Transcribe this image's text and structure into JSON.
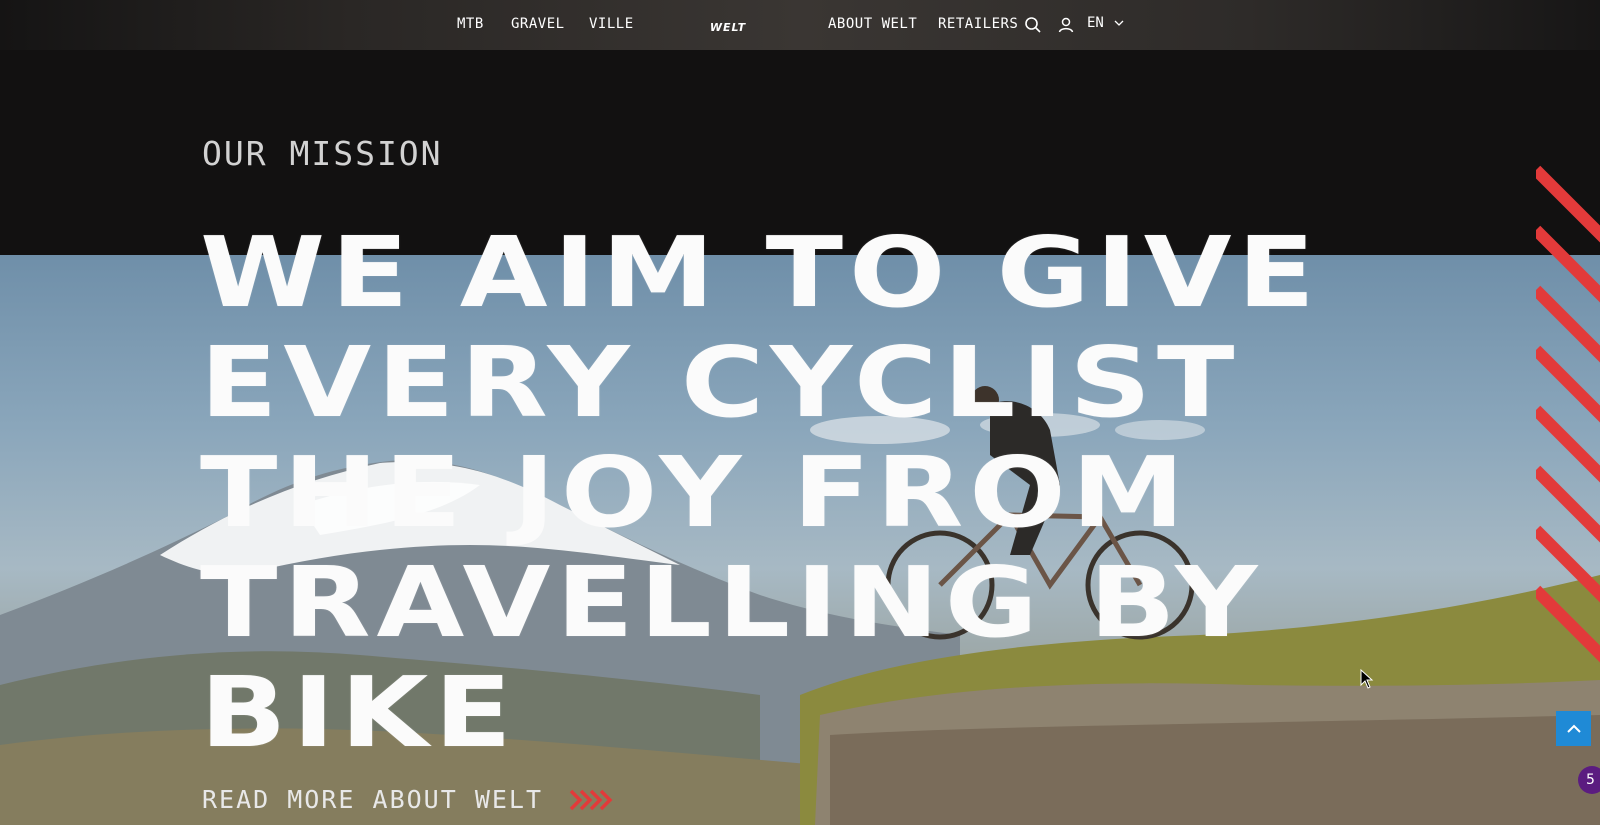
{
  "nav": {
    "left_links": [
      "MTB",
      "GRAVEL",
      "VILLE"
    ],
    "right_links": [
      "ABOUT WELT",
      "RETAILERS"
    ],
    "logo_text": "WELT",
    "language": "EN",
    "icons": [
      "search-icon",
      "user-icon",
      "chevron-down-icon"
    ]
  },
  "hero": {
    "eyebrow": "OUR MISSION",
    "headline_lines": [
      "WE AIM TO GIVE",
      "EVERY CYCLIST",
      "THE JOY FROM",
      "TRAVELLING BY",
      "BIKE"
    ],
    "cta_label": "READ MORE ABOUT WELT"
  },
  "widgets": {
    "notification_count": "5"
  },
  "colors": {
    "accent_red": "#e23a3a",
    "background_dark": "#121111",
    "back_to_top_blue": "#1f8ad6",
    "badge_purple": "#5b1c80"
  }
}
